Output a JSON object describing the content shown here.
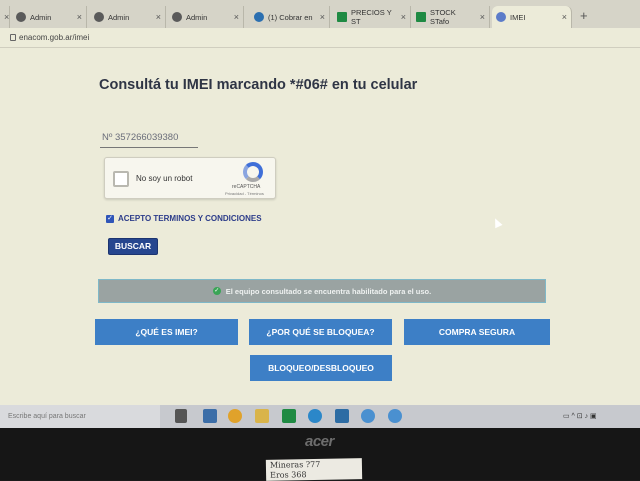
{
  "browser": {
    "tabs": [
      {
        "label": "Admin",
        "icon": "github-icon"
      },
      {
        "label": "Admin",
        "icon": "github-icon"
      },
      {
        "label": "Admin",
        "icon": "github-icon"
      },
      {
        "label": "(1) Cobrar en",
        "icon": "payment-icon"
      },
      {
        "label": "PRECIOS Y ST",
        "icon": "sheet-icon"
      },
      {
        "label": "STOCK STafo",
        "icon": "sheet-icon"
      },
      {
        "label": "IMEI",
        "icon": "enacom-icon"
      }
    ],
    "url": "enacom.gob.ar/imei"
  },
  "page": {
    "title": "Consultá tu IMEI marcando *#06# en tu celular",
    "imei_value": "Nº  357266039380",
    "recaptcha": {
      "label": "No soy un robot",
      "brand": "reCAPTCHA",
      "links": "Privacidad - Términos"
    },
    "accept_label": "ACEPTO TERMINOS Y CONDICIONES",
    "search_button": "BUSCAR",
    "status_message": "El equipo consultado se encuentra habilitado para el uso.",
    "nav_buttons": {
      "what_is": "¿QUÉ ES IMEI?",
      "why_blocked": "¿POR QUÉ SE BLOQUEA?",
      "safe_buy": "COMPRA SEGURA",
      "block_unblock": "BLOQUEO/DESBLOQUEO"
    }
  },
  "taskbar": {
    "search_placeholder": "Escribe aquí para buscar"
  },
  "monitor": {
    "brand": "acer",
    "note_line1": "Mineras  ?77",
    "note_line2": "Eros   368"
  },
  "colors": {
    "accent": "#3d7fc6",
    "primary_dark": "#26468f",
    "status_bar": "#9aa3a2",
    "success": "#3aa556"
  }
}
